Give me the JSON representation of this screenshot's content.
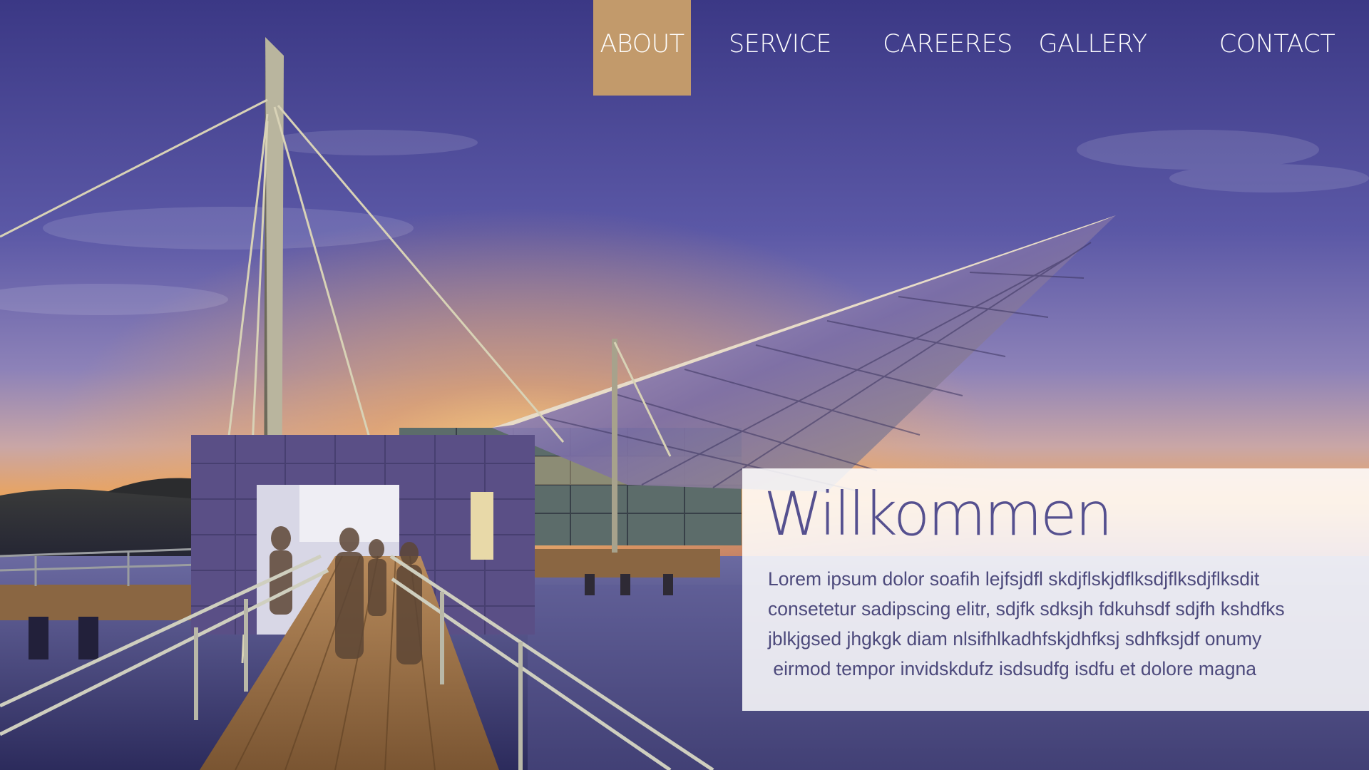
{
  "nav": {
    "items": [
      {
        "label": "ABOUT",
        "active": true
      },
      {
        "label": "SERVICE",
        "active": false
      },
      {
        "label": "CAREERES",
        "active": false
      },
      {
        "label": "GALLERY",
        "active": false
      },
      {
        "label": "CONTACT",
        "active": false
      }
    ]
  },
  "welcome": {
    "title": "Willkommen",
    "lines": [
      "Lorem ipsum dolor soafih lejfsjdfl skdjflskjdflksdjflksdjflksdit",
      "consetetur sadipscing elitr, sdjfk sdksjh fdkuhsdf sdjfh kshdfks",
      "jblkjgsed jhgkgk diam nlsifhlkadhfskjdhfksj sdhfksjdf onumy",
      " eirmod tempor invidskdufz isdsudfg isdfu et dolore magna"
    ]
  },
  "colors": {
    "nav_active": "#c29a6b",
    "title": "#55508f",
    "body_text": "#4d4a7c",
    "sky_top": "#3d3a86",
    "sunset": "#f0a852"
  },
  "hero": {
    "subject": "architectural rendering of a glass building and footbridge at sunset"
  }
}
